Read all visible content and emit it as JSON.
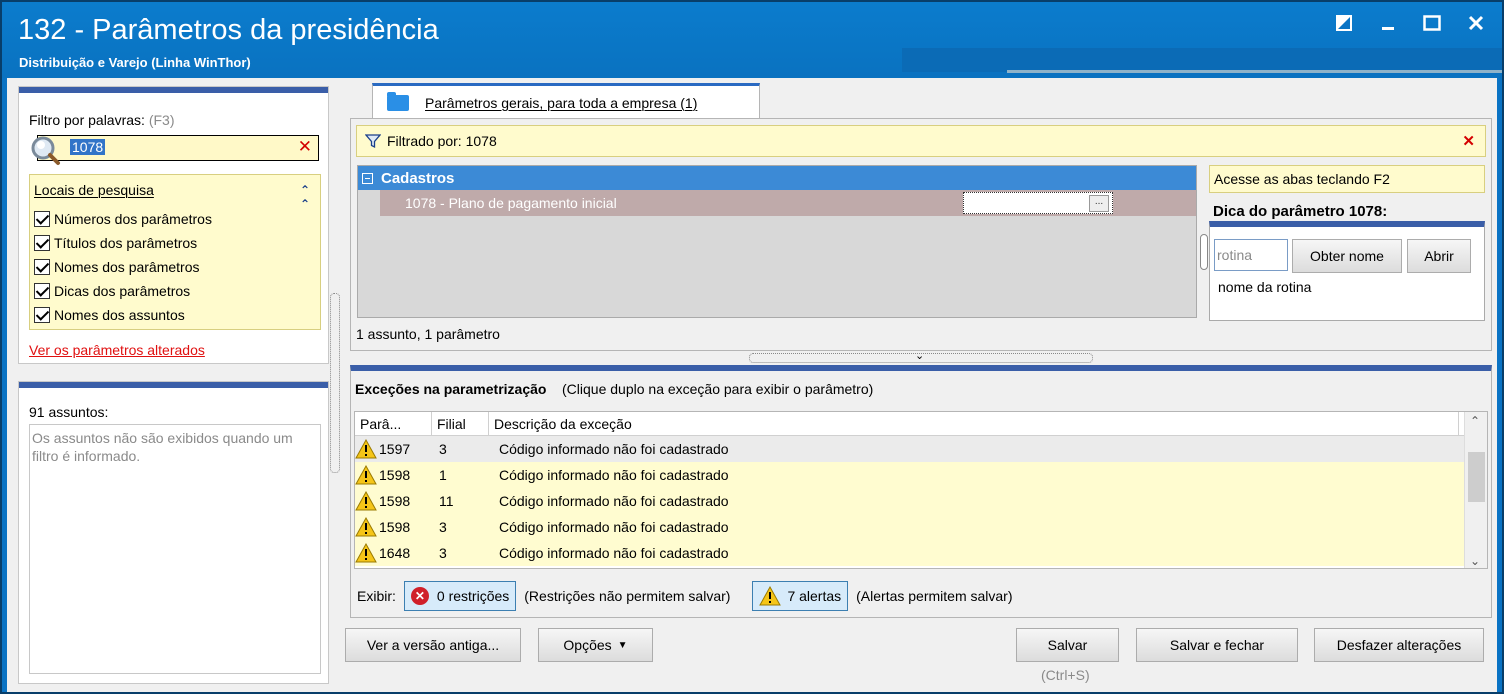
{
  "window": {
    "title": "132 - Parâmetros da presidência",
    "subtitle": "Distribuição e Varejo (Linha WinThor)",
    "buttons": [
      "restore-down",
      "minimize",
      "maximize",
      "close"
    ]
  },
  "filter": {
    "label": "Filtro por palavras:",
    "shortcut": "(F3)",
    "value": "1078"
  },
  "locais": {
    "title": "Locais de pesquisa",
    "options": [
      {
        "label": "Números dos parâmetros",
        "checked": true
      },
      {
        "label": "Títulos dos parâmetros",
        "checked": true
      },
      {
        "label": "Nomes dos parâmetros",
        "checked": true
      },
      {
        "label": "Dicas dos parâmetros",
        "checked": true
      },
      {
        "label": "Nomes dos assuntos",
        "checked": true
      }
    ],
    "link": "Ver os parâmetros alterados"
  },
  "assuntos": {
    "label": "91 assuntos:",
    "message": "Os assuntos não são exibidos quando um filtro é informado."
  },
  "tab": {
    "label": "Parâmetros gerais, para toda a empresa  (1)"
  },
  "filtered": {
    "label": "Filtrado por: 1078"
  },
  "tree": {
    "group": "Cadastros",
    "row": "1078 - Plano de pagamento inicial",
    "value_button": "..."
  },
  "count_label": "1 assunto, 1 parâmetro",
  "dica": {
    "hint": "Acesse as abas teclando F2",
    "title": "Dica do parâmetro 1078:",
    "input_placeholder": "rotina",
    "obter_button": "Obter nome",
    "abrir_button": "Abrir",
    "nome_label": "nome da rotina"
  },
  "excecoes": {
    "title": "Exceções na parametrização",
    "subtitle": "(Clique duplo na exceção para exibir o parâmetro)",
    "columns": [
      "Parâ...",
      "Filial",
      "Descrição da exceção"
    ],
    "rows": [
      {
        "param": "1597",
        "filial": "3",
        "desc": "Código informado não foi cadastrado"
      },
      {
        "param": "1598",
        "filial": "1",
        "desc": "Código informado não foi cadastrado"
      },
      {
        "param": "1598",
        "filial": "11",
        "desc": "Código informado não foi cadastrado"
      },
      {
        "param": "1598",
        "filial": "3",
        "desc": "Código informado não foi cadastrado"
      },
      {
        "param": "1648",
        "filial": "3",
        "desc": "Código informado não foi cadastrado"
      }
    ],
    "exibir_label": "Exibir:",
    "restricoes_button": "0 restrições",
    "restricoes_note": "(Restrições não permitem salvar)",
    "alertas_button": "7 alertas",
    "alertas_note": "(Alertas permitem salvar)"
  },
  "footer": {
    "versao_antiga": "Ver a versão antiga...",
    "opcoes": "Opções",
    "salvar": "Salvar",
    "salvar_shortcut": "(Ctrl+S)",
    "salvar_fechar": "Salvar e fechar",
    "desfazer": "Desfazer alterações"
  },
  "colors": {
    "title_bar": "#0a73c4",
    "accent": "#3a5ea8",
    "highlight_yellow": "#fffbcd",
    "tree_header": "#3c8ad6",
    "error_red": "#d40000"
  }
}
